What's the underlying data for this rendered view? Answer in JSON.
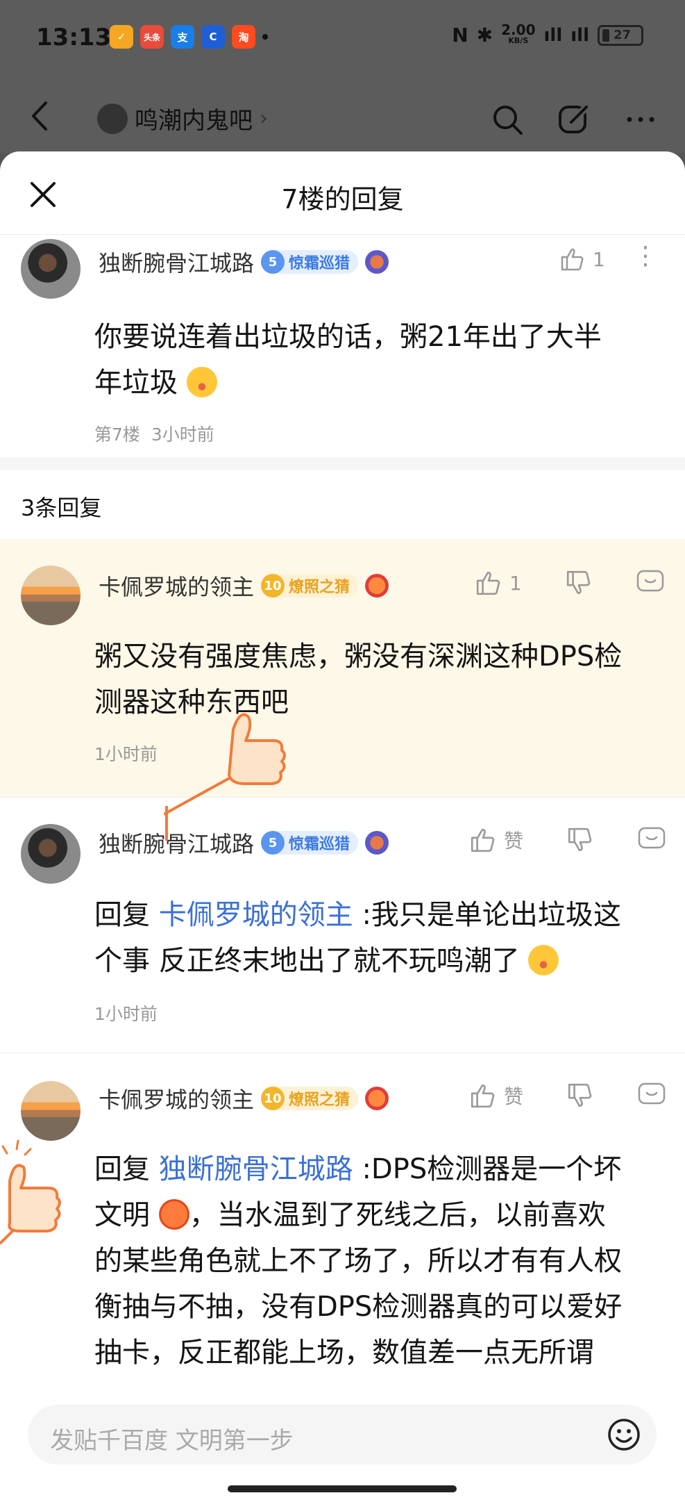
{
  "status": {
    "time": "13:13",
    "apps": [
      {
        "label": "✓",
        "color": "#f5a623"
      },
      {
        "label": "头条",
        "color": "#e84b3c"
      },
      {
        "label": "支",
        "color": "#1a7ee8"
      },
      {
        "label": "C",
        "color": "#1e5fd6"
      },
      {
        "label": "淘",
        "color": "#ff4b1f"
      }
    ],
    "speed_top": "2.00",
    "speed_unit": "KB/S",
    "battery": "27"
  },
  "appbar": {
    "forum_name": "鸣潮内鬼吧"
  },
  "sheet": {
    "title": "7楼的回复"
  },
  "main_post": {
    "username": "独断腕骨江城路",
    "badge_level": "5",
    "badge_text": "惊霜巡猎",
    "likes": "1",
    "text_line1": "你要说连着出垃圾的话，粥21年出了大半",
    "text_line2": "年垃圾",
    "floor": "第7楼",
    "time": "3小时前"
  },
  "replies_count": "3条回复",
  "replies": [
    {
      "username": "卡佩罗城的领主",
      "badge_level": "10",
      "badge_text": "燎照之猜",
      "likes": "1",
      "line1": "粥又没有强度焦虑，粥没有深渊这种DPS检",
      "line2": "测器这种东西吧",
      "time": "1小时前"
    },
    {
      "username": "独断腕骨江城路",
      "badge_level": "5",
      "badge_text": "惊霜巡猎",
      "likes": "赞",
      "reply_prefix": "回复",
      "reply_to": "卡佩罗城的领主",
      "line1_rest": ":我只是单论出垃圾这",
      "line2": "个事 反正终末地出了就不玩鸣潮了",
      "time": "1小时前"
    },
    {
      "username": "卡佩罗城的领主",
      "badge_level": "10",
      "badge_text": "燎照之猜",
      "likes": "赞",
      "reply_prefix": "回复",
      "reply_to": "独断腕骨江城路",
      "line1_rest": ":DPS检测器是一个坏",
      "line2a": "文明",
      "line2b": "，当水温到了死线之后，以前喜欢",
      "line3": "的某些角色就上不了场了，所以才有有人权",
      "line4": "衡抽与不抽，没有DPS检测器真的可以爱好",
      "line5": "抽卡，反正都能上场，数值差一点无所谓"
    }
  ],
  "input": {
    "placeholder": "发贴千百度 文明第一步"
  }
}
